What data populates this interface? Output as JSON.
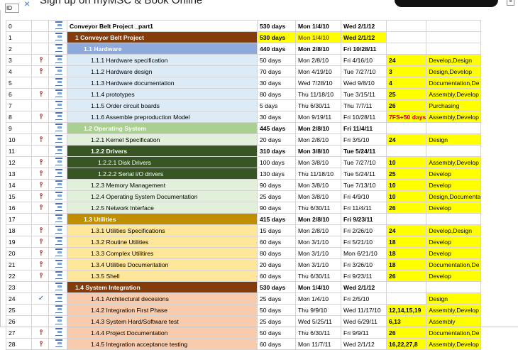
{
  "window": {
    "title": "Sign up on myMSC & Book Online",
    "close_glyph": "×",
    "corner_glyph": "≡"
  },
  "grid": {
    "id_header": "ID",
    "colors": {
      "project_brown": "#843c0c",
      "hardware_blue": "#8ea9db",
      "hardware_child": "#ddebf7",
      "os_green": "#a9d08e",
      "os_child": "#e2efda",
      "drivers_dark": "#375623",
      "utilities_gold": "#bf8f00",
      "utilities_child": "#ffe699",
      "integration_child": "#f8cbad",
      "highlight_yellow": "#ffff00"
    },
    "rows": [
      {
        "id": "0",
        "icon": "",
        "name": "Conveyor Belt Project _part1",
        "dur": "530 days",
        "start": "Mon 1/4/10",
        "finish": "Wed 2/1/12",
        "pred": "",
        "res": "",
        "style": "root"
      },
      {
        "id": "1",
        "icon": "",
        "name": "1 Conveyor Belt Project",
        "dur": "530 days",
        "start": "Mon 1/4/10",
        "finish": "Wed 2/1/12",
        "pred": "",
        "res": "",
        "style": "proj"
      },
      {
        "id": "2",
        "icon": "",
        "name": "1.1 Hardware",
        "dur": "440 days",
        "start": "Mon 2/8/10",
        "finish": "Fri 10/28/11",
        "pred": "",
        "res": "",
        "style": "hw"
      },
      {
        "id": "3",
        "icon": "pin",
        "name": "1.1.1 Hardware specification",
        "dur": "50 days",
        "start": "Mon 2/8/10",
        "finish": "Fri 4/16/10",
        "pred": "24",
        "res": "Develop,Design",
        "style": "hwc"
      },
      {
        "id": "4",
        "icon": "pin",
        "name": "1.1.2 Hardware design",
        "dur": "70 days",
        "start": "Mon 4/19/10",
        "finish": "Tue 7/27/10",
        "pred": "3",
        "res": "Design,Develop",
        "style": "hwc"
      },
      {
        "id": "5",
        "icon": "",
        "name": "1.1.3 Hardware documentation",
        "dur": "30 days",
        "start": "Wed 7/28/10",
        "finish": "Wed 9/8/10",
        "pred": "4",
        "res": "Documentation,De",
        "style": "hwc"
      },
      {
        "id": "6",
        "icon": "pin",
        "name": "1.1.4 prototypes",
        "dur": "80 days",
        "start": "Thu 11/18/10",
        "finish": "Tue 3/15/11",
        "pred": "25",
        "res": "Assembly,Develop",
        "style": "hwc"
      },
      {
        "id": "7",
        "icon": "",
        "name": "1.1.5 Order circuit boards",
        "dur": "5 days",
        "start": "Thu 6/30/11",
        "finish": "Thu 7/7/11",
        "pred": "26",
        "res": "Purchasing",
        "style": "hwc"
      },
      {
        "id": "8",
        "icon": "pin",
        "name": "1.1.6 Assemble preproduction Model",
        "dur": "30 days",
        "start": "Mon 9/19/11",
        "finish": "Fri 10/28/11",
        "pred": "7FS+50 days",
        "res": "Assembly,Develop",
        "style": "hwc"
      },
      {
        "id": "9",
        "icon": "",
        "name": "1.2 Operating System",
        "dur": "445 days",
        "start": "Mon 2/8/10",
        "finish": "Fri 11/4/11",
        "pred": "",
        "res": "",
        "style": "os"
      },
      {
        "id": "10",
        "icon": "pin",
        "name": "1.2.1 Kernel Specification",
        "dur": "20 days",
        "start": "Mon 2/8/10",
        "finish": "Fri 3/5/10",
        "pred": "24",
        "res": "Design",
        "style": "osc"
      },
      {
        "id": "11",
        "icon": "",
        "name": "1.2.2 Drivers",
        "dur": "310 days",
        "start": "Mon 3/8/10",
        "finish": "Tue 5/24/11",
        "pred": "",
        "res": "",
        "style": "drv"
      },
      {
        "id": "12",
        "icon": "pin",
        "name": "1.2.2.1 Disk Drivers",
        "dur": "100 days",
        "start": "Mon 3/8/10",
        "finish": "Tue 7/27/10",
        "pred": "10",
        "res": "Assembly,Develop",
        "style": "drvc"
      },
      {
        "id": "13",
        "icon": "pin",
        "name": "1.2.2.2 Serial i/O drivers",
        "dur": "130 days",
        "start": "Thu 11/18/10",
        "finish": "Tue 5/24/11",
        "pred": "25",
        "res": "Develop",
        "style": "drvc"
      },
      {
        "id": "14",
        "icon": "pin",
        "name": "1.2.3 Memory Management",
        "dur": "90 days",
        "start": "Mon 3/8/10",
        "finish": "Tue 7/13/10",
        "pred": "10",
        "res": "Develop",
        "style": "osc"
      },
      {
        "id": "15",
        "icon": "pin",
        "name": "1.2.4 Operating System Documentation",
        "dur": "25 days",
        "start": "Mon 3/8/10",
        "finish": "Fri 4/9/10",
        "pred": "10",
        "res": "Design,Documenta",
        "style": "osc"
      },
      {
        "id": "16",
        "icon": "pin",
        "name": "1.2.5 Network Interface",
        "dur": "90 days",
        "start": "Thu 6/30/11",
        "finish": "Fri 11/4/11",
        "pred": "26",
        "res": "Develop",
        "style": "osc"
      },
      {
        "id": "17",
        "icon": "",
        "name": "1.3 Utilities",
        "dur": "415 days",
        "start": "Mon 2/8/10",
        "finish": "Fri 9/23/11",
        "pred": "",
        "res": "",
        "style": "ut"
      },
      {
        "id": "18",
        "icon": "pin",
        "name": "1.3.1 Utilities Specifications",
        "dur": "15 days",
        "start": "Mon 2/8/10",
        "finish": "Fri 2/26/10",
        "pred": "24",
        "res": "Develop,Design",
        "style": "utc"
      },
      {
        "id": "19",
        "icon": "pin",
        "name": "1.3.2 Routine Utilities",
        "dur": "60 days",
        "start": "Mon 3/1/10",
        "finish": "Fri 5/21/10",
        "pred": "18",
        "res": "Develop",
        "style": "utc"
      },
      {
        "id": "20",
        "icon": "pin",
        "name": "1.3.3 Complex Utilitires",
        "dur": "80 days",
        "start": "Mon 3/1/10",
        "finish": "Mon 6/21/10",
        "pred": "18",
        "res": "Develop",
        "style": "utc"
      },
      {
        "id": "21",
        "icon": "pin",
        "name": "1.3.4 Utilities Documentation",
        "dur": "20 days",
        "start": "Mon 3/1/10",
        "finish": "Fri 3/26/10",
        "pred": "18",
        "res": "Documentation,De",
        "style": "utc"
      },
      {
        "id": "22",
        "icon": "pin",
        "name": "1.3.5 Shell",
        "dur": "60 days",
        "start": "Thu 6/30/11",
        "finish": "Fri 9/23/11",
        "pred": "26",
        "res": "Develop",
        "style": "utc"
      },
      {
        "id": "23",
        "icon": "",
        "name": "1.4 System Integration",
        "dur": "530 days",
        "start": "Mon 1/4/10",
        "finish": "Wed 2/1/12",
        "pred": "",
        "res": "",
        "style": "proj"
      },
      {
        "id": "24",
        "icon": "check",
        "name": "1.4.1 Architectural decesions",
        "dur": "25 days",
        "start": "Mon 1/4/10",
        "finish": "Fri 2/5/10",
        "pred": "",
        "res": "Design",
        "style": "sic"
      },
      {
        "id": "25",
        "icon": "",
        "name": "1.4.2 Integration First Phase",
        "dur": "50 days",
        "start": "Thu 9/9/10",
        "finish": "Wed 11/17/10",
        "pred": "12,14,15,19",
        "res": "Assembly,Develop",
        "style": "sic"
      },
      {
        "id": "26",
        "icon": "",
        "name": "1.4.3 System Hard/Software test",
        "dur": "25 days",
        "start": "Wed 5/25/11",
        "finish": "Wed 6/29/11",
        "pred": "6,13",
        "res": "Assembly",
        "style": "sic"
      },
      {
        "id": "27",
        "icon": "pin",
        "name": "1.4.4 Project Documentation",
        "dur": "50 days",
        "start": "Thu 6/30/11",
        "finish": "Fri 9/9/11",
        "pred": "26",
        "res": "Documentation,De",
        "style": "sic"
      },
      {
        "id": "28",
        "icon": "pin",
        "name": "1.4.5 Integration acceptance testing",
        "dur": "60 days",
        "start": "Mon 11/7/11",
        "finish": "Wed 2/1/12",
        "pred": "16,22,27,8",
        "res": "Assembly,Develop",
        "style": "sic"
      }
    ]
  }
}
